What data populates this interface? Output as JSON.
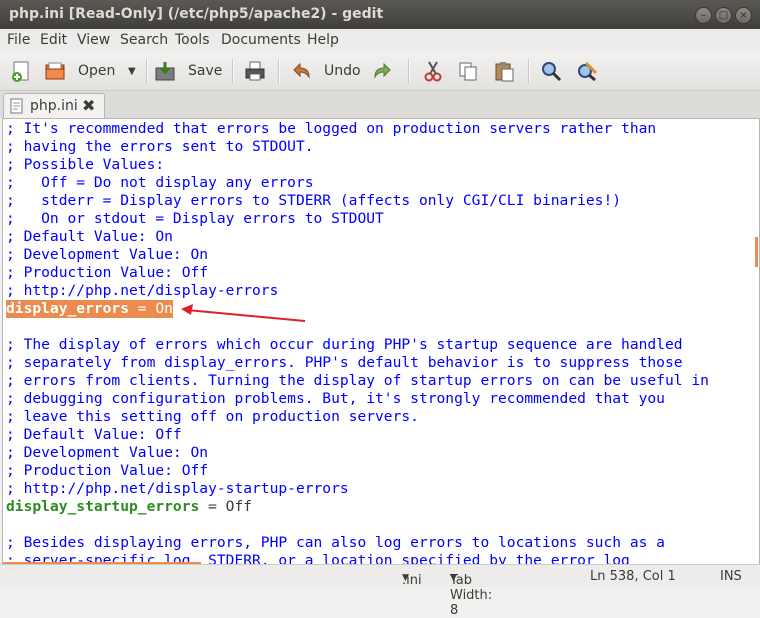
{
  "window": {
    "title": "php.ini [Read-Only] (/etc/php5/apache2) - gedit"
  },
  "menu": [
    "File",
    "Edit",
    "View",
    "Search",
    "Tools",
    "Documents",
    "Help"
  ],
  "toolbar": {
    "open_label": "Open",
    "save_label": "Save",
    "undo_label": "Undo"
  },
  "tab": {
    "label": "php.ini"
  },
  "editor": {
    "lines": [
      {
        "text": "; It's recommended that errors be logged on production servers rather than",
        "kind": "comment"
      },
      {
        "text": "; having the errors sent to STDOUT.",
        "kind": "comment"
      },
      {
        "text": "; Possible Values:",
        "kind": "comment"
      },
      {
        "text": ";   Off = Do not display any errors",
        "kind": "comment"
      },
      {
        "text": ";   stderr = Display errors to STDERR (affects only CGI/CLI binaries!)",
        "kind": "comment"
      },
      {
        "text": ";   On or stdout = Display errors to STDOUT",
        "kind": "comment"
      },
      {
        "text": "; Default Value: On",
        "kind": "comment"
      },
      {
        "text": "; Development Value: On",
        "kind": "comment"
      },
      {
        "text": "; Production Value: Off",
        "kind": "comment"
      },
      {
        "text": "; http://php.net/display-errors",
        "kind": "comment"
      },
      {
        "key": "display_errors",
        "rest": " = On",
        "kind": "directive-highlighted"
      },
      {
        "text": "",
        "kind": "blank"
      },
      {
        "text": "; The display of errors which occur during PHP's startup sequence are handled",
        "kind": "comment"
      },
      {
        "text": "; separately from display_errors. PHP's default behavior is to suppress those",
        "kind": "comment"
      },
      {
        "text": "; errors from clients. Turning the display of startup errors on can be useful in",
        "kind": "comment"
      },
      {
        "text": "; debugging configuration problems. But, it's strongly recommended that you",
        "kind": "comment"
      },
      {
        "text": "; leave this setting off on production servers.",
        "kind": "comment"
      },
      {
        "text": "; Default Value: Off",
        "kind": "comment"
      },
      {
        "text": "; Development Value: On",
        "kind": "comment"
      },
      {
        "text": "; Production Value: Off",
        "kind": "comment"
      },
      {
        "text": "; http://php.net/display-startup-errors",
        "kind": "comment"
      },
      {
        "key": "display_startup_errors",
        "rest": " = Off",
        "kind": "directive"
      },
      {
        "text": "",
        "kind": "blank"
      },
      {
        "text": "; Besides displaying errors, PHP can also log errors to locations such as a",
        "kind": "comment"
      },
      {
        "text": "; server-specific log, STDERR, or a location specified by the error_log",
        "kind": "comment"
      }
    ]
  },
  "statusbar": {
    "language": ".ini",
    "tab_width": "Tab Width: 8",
    "position": "Ln 538, Col 1",
    "mode": "INS"
  },
  "colors": {
    "comment": "#0000ff",
    "keyword": "#2e8b22",
    "highlight": "#ec8b4e",
    "arrow": "#e0202a"
  }
}
